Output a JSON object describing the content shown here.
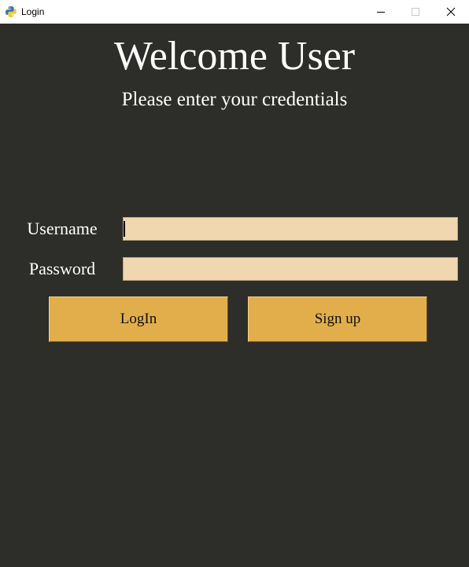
{
  "window": {
    "title": "Login",
    "icon": "python-icon",
    "controls": [
      "minimize-icon",
      "maximize-icon",
      "close-icon"
    ]
  },
  "header": {
    "title": "Welcome User",
    "subtitle": "Please enter your credentials"
  },
  "form": {
    "username_label": "Username",
    "username_value": "",
    "password_label": "Password",
    "password_value": ""
  },
  "buttons": {
    "login_label": "LogIn",
    "signup_label": "Sign up"
  },
  "colors": {
    "background": "#2d2d29",
    "input_fill": "#f0d7b0",
    "button_fill": "#e2ae4c",
    "text_light": "#ffffff"
  }
}
